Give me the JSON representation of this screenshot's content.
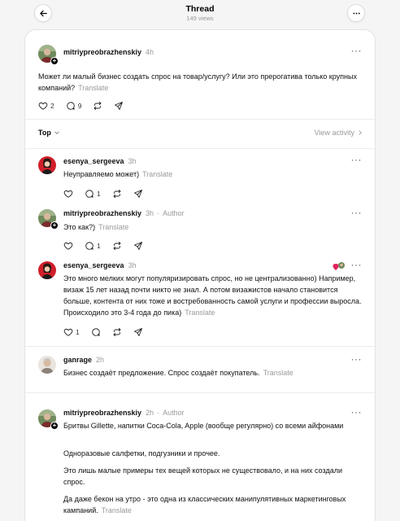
{
  "header": {
    "title": "Thread",
    "views": "149 views"
  },
  "sort": {
    "label": "Top",
    "view_activity": "View activity"
  },
  "translate_label": "Translate",
  "author_label": "Author",
  "main_post": {
    "username": "mitriypreobrazhenskiy",
    "time": "4h",
    "text": "Может ли малый бизнес создать спрос на товар/услугу? Или это прерогатива только крупных компаний?",
    "likes": "2",
    "replies": "9"
  },
  "replies": [
    {
      "username": "esenya_sergeeva",
      "time": "3h",
      "text": "Неуправляемо может)",
      "likes": "",
      "replies": "1"
    },
    {
      "username": "mitriypreobrazhenskiy",
      "time": "3h",
      "text": "Это как?)",
      "likes": "",
      "replies": "1"
    },
    {
      "username": "esenya_sergeeva",
      "time": "3h",
      "text": "Это много мелких могут популяризировать спрос, но не централизованно) Например, визаж 15 лет назад почти никто не знал. А потом визажистов начало становится больше, контента от них тоже и востребованность самой услуги и профессии выросла. Происходило это 3-4 года до пика)",
      "likes": "1",
      "replies": ""
    },
    {
      "username": "ganrage",
      "time": "2h",
      "text": "Бизнес создаёт предложение. Спрос создаёт покупатель."
    },
    {
      "username": "mitriypreobrazhenskiy",
      "time": "2h",
      "paragraphs": [
        "Бритвы Gillette, напитки Coca-Cola, Apple (вообще регулярно) со всеми айфонами",
        "Одноразовые салфетки, подгузники и прочее.",
        "Это лишь малые примеры тех вещей которых не существовало, и на них создали спрос.",
        "Да даже бекон на утро - это одна из классических манипулятивных маркетинговых кампаний."
      ]
    }
  ],
  "icons": {
    "back": "arrow-left-icon",
    "more": "more-horizontal-icon",
    "like": "heart-icon",
    "reply": "comment-icon",
    "repost": "repost-icon",
    "share": "send-icon",
    "sort": "chevron-down-icon",
    "activity": "chevron-right-icon"
  },
  "colors": {
    "background": "#f5f5f5",
    "card": "#ffffff",
    "muted": "#999999"
  }
}
